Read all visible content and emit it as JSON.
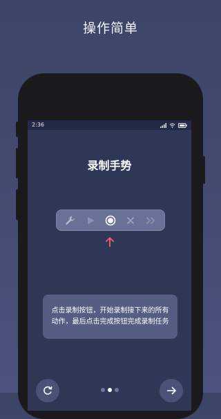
{
  "promo": {
    "title": "操作简单"
  },
  "status": {
    "time": "2:36"
  },
  "screen": {
    "title": "录制手势",
    "toolbar": [
      {
        "icon": "wrench-icon"
      },
      {
        "icon": "play-icon"
      },
      {
        "icon": "record-icon"
      },
      {
        "icon": "close-icon"
      },
      {
        "icon": "fast-forward-icon"
      }
    ],
    "tooltip": "点击录制按钮，开始录制接下来的所有动作，最后点击完成按钮完成录制任务"
  },
  "pager": {
    "count": 3,
    "active": 2
  },
  "colors": {
    "pointer_arrow": "#f0606e",
    "background": "#454d74",
    "screen": "#2f3757"
  }
}
